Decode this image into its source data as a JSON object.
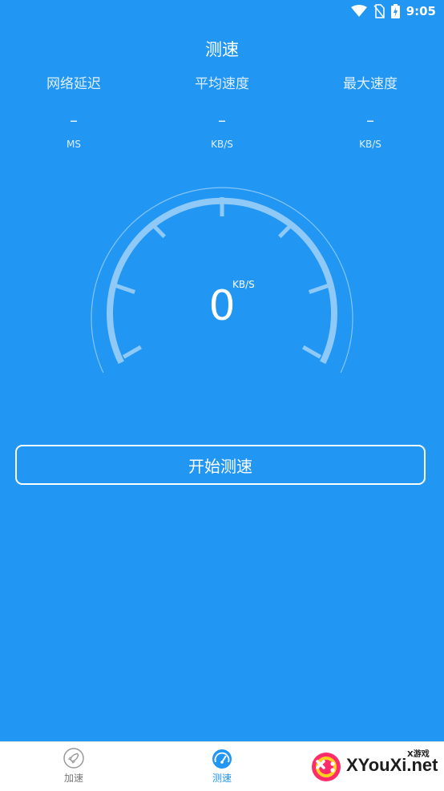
{
  "status_bar": {
    "time": "9:05"
  },
  "page": {
    "title": "测速"
  },
  "stats": [
    {
      "label": "网络延迟",
      "value": "–",
      "unit": "MS"
    },
    {
      "label": "平均速度",
      "value": "–",
      "unit": "KB/S"
    },
    {
      "label": "最大速度",
      "value": "–",
      "unit": "KB/S"
    }
  ],
  "gauge": {
    "value": "0",
    "unit": "KB/S"
  },
  "start_button": {
    "label": "开始测速"
  },
  "bottom_nav": {
    "items": [
      {
        "label": "加速",
        "icon": "rocket-icon",
        "active": false
      },
      {
        "label": "测速",
        "icon": "speedometer-icon",
        "active": true
      }
    ]
  },
  "watermark": {
    "brand": "XYouXi.net",
    "small": "X游戏"
  },
  "colors": {
    "background": "#2196F3",
    "gauge_arc": "#8EC9F8",
    "nav_active": "#2196F3",
    "nav_inactive": "#777777"
  }
}
